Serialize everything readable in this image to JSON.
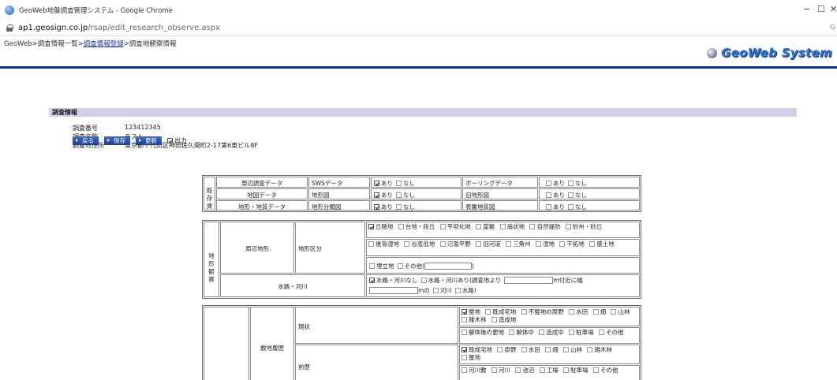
{
  "window": {
    "title": "GeoWeb地盤調査管理システム - Google Chrome",
    "url_host": "ap1.geosign.co.jp",
    "url_path": "/rsap/edit_research_observe.aspx",
    "minimize": "−",
    "maximize": "☐",
    "close": "✕"
  },
  "header": {
    "breadcrumb": {
      "part1": "GeoWeb>",
      "part2": "調査情報一覧>",
      "link": "調査情報登録",
      "part3": ">調査地観察情報"
    },
    "logo_text": "GeoWeb System"
  },
  "survey_info": {
    "title": "調査情報",
    "number_label": "調査番号",
    "number_value": "123412345",
    "name_label": "調査名称",
    "name_value": "テスト",
    "address_label": "調査地住所",
    "address_value": "東京都千代田区神田佐久間町2-17第6東ビル8F",
    "buttons": {
      "back": "戻る",
      "save": "保存",
      "update": "更新"
    },
    "output_label": "出力",
    "output_checked": true
  },
  "existing_data": {
    "group_label": "既存資料",
    "rows": [
      {
        "category": "周辺調査データ",
        "item": "SWSデータ",
        "yes": "あり",
        "no": "なし",
        "checked": "yes",
        "item2": "ボーリングデータ",
        "yes2": "あり",
        "no2": "なし"
      },
      {
        "category": "地図データ",
        "item": "地形図",
        "yes": "あり",
        "no": "なし",
        "checked": "yes",
        "item2": "旧地形図",
        "yes2": "あり",
        "no2": "なし"
      },
      {
        "category": "地形・地質データ",
        "item": "地形分類図",
        "yes": "あり",
        "no": "なし",
        "checked": "yes",
        "item2": "表層地質図",
        "yes2": "あり",
        "no2": "なし"
      }
    ]
  },
  "terrain": {
    "group_label": "地形観察",
    "surrounding_label": "周辺地形",
    "class_label": "地形区分",
    "row1_options": [
      "丘陵地",
      "台地・段丘",
      "平坦化地",
      "崖錐",
      "扇状地",
      "自然堤防",
      "砂州・砂丘"
    ],
    "row2_options": [
      "後背湿地",
      "谷底低地",
      "氾濫平野",
      "旧河道",
      "三角州",
      "湿地",
      "干拓地",
      "盛土地"
    ],
    "row3_options": [
      "埋立地",
      "その他("
    ],
    "row3_close": ")",
    "water_label": "水路・河川",
    "water_opt1": "水路・河川なし",
    "water_opt2": "水路・河川あり(調査地より",
    "water_suffix1": "m付近に幅",
    "water_suffix2": "mの",
    "water_opt3": "河川",
    "water_opt4": "水路)"
  },
  "site_history": {
    "group_label": "敷地履歴",
    "current_label": "現状",
    "current_row1": [
      "整地",
      "既成宅地",
      "不整地の原野",
      "水田",
      "畑",
      "山林",
      "雑木林",
      "造成地"
    ],
    "current_row2": [
      "解体後の更地",
      "解体中",
      "造成中",
      "駐車場",
      "その他"
    ],
    "previous_label": "前歴",
    "previous_row1": [
      "既成宅地",
      "原野",
      "水田",
      "畑",
      "山林",
      "雑木林",
      "屋地"
    ],
    "previous_row2": [
      "河川敷",
      "河川",
      "池沼",
      "工場",
      "駐車場",
      "その他"
    ]
  }
}
